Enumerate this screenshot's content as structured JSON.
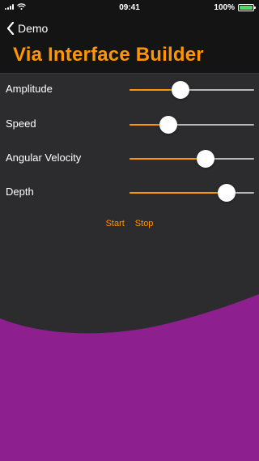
{
  "status_bar": {
    "time": "09:41",
    "battery_percent": "100%",
    "battery_level": 1.0
  },
  "nav": {
    "back_label": "Demo",
    "title": "Via Interface Builder"
  },
  "sliders": [
    {
      "label": "Amplitude",
      "value": 0.41
    },
    {
      "label": "Speed",
      "value": 0.31
    },
    {
      "label": "Angular Velocity",
      "value": 0.61
    },
    {
      "label": "Depth",
      "value": 0.78
    }
  ],
  "controls": {
    "start_label": "Start",
    "stop_label": "Stop"
  },
  "colors": {
    "accent": "#ff9500",
    "wave": "#8e1f8e",
    "background": "#2c2c2e",
    "bar": "#141414"
  }
}
